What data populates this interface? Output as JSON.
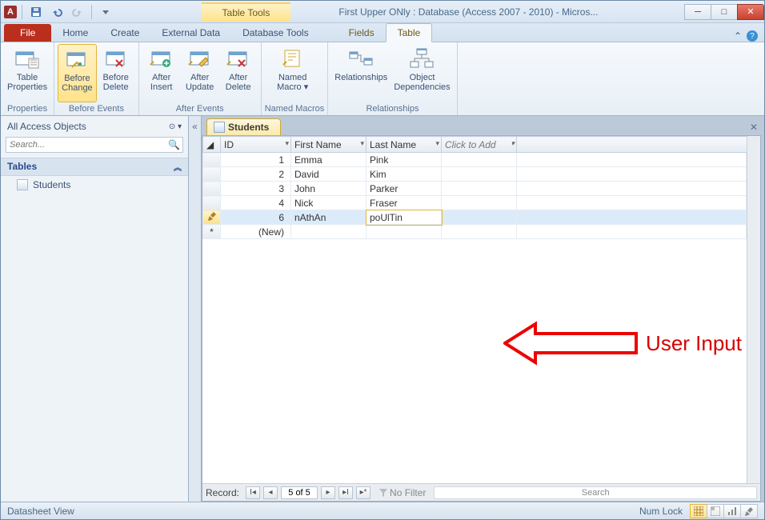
{
  "window": {
    "title": "First Upper ONly : Database (Access 2007 - 2010)  -  Micros...",
    "contextual_tab": "Table Tools"
  },
  "ribbon_tabs": {
    "file": "File",
    "home": "Home",
    "create": "Create",
    "external": "External Data",
    "dbtools": "Database Tools",
    "fields": "Fields",
    "table": "Table"
  },
  "ribbon": {
    "properties": {
      "table_properties": "Table\nProperties",
      "label": "Properties"
    },
    "before_events": {
      "before_change": "Before\nChange",
      "before_delete": "Before\nDelete",
      "label": "Before Events"
    },
    "after_events": {
      "after_insert": "After\nInsert",
      "after_update": "After\nUpdate",
      "after_delete": "After\nDelete",
      "label": "After Events"
    },
    "named_macros": {
      "named_macro": "Named\nMacro ▾",
      "label": "Named Macros"
    },
    "relationships": {
      "relationships": "Relationships",
      "object_deps": "Object\nDependencies",
      "label": "Relationships"
    }
  },
  "nav": {
    "header": "All Access Objects",
    "search_placeholder": "Search...",
    "section_tables": "Tables",
    "items": [
      {
        "label": "Students"
      }
    ]
  },
  "doc": {
    "tab": "Students",
    "columns": {
      "id": "ID",
      "first": "First Name",
      "last": "Last Name",
      "add": "Click to Add"
    },
    "rows": [
      {
        "id": "1",
        "first": "Emma",
        "last": "Pink"
      },
      {
        "id": "2",
        "first": "David",
        "last": "Kim"
      },
      {
        "id": "3",
        "first": "John",
        "last": "Parker"
      },
      {
        "id": "4",
        "first": "Nick",
        "last": "Fraser"
      },
      {
        "id": "6",
        "first": "nAthAn",
        "last": "poUlTin",
        "editing": true
      }
    ],
    "new_row": "(New)"
  },
  "recnav": {
    "label": "Record:",
    "position": "5 of 5",
    "no_filter": "No Filter",
    "search": "Search"
  },
  "statusbar": {
    "view": "Datasheet View",
    "numlock": "Num Lock"
  },
  "annotation": "User Input"
}
